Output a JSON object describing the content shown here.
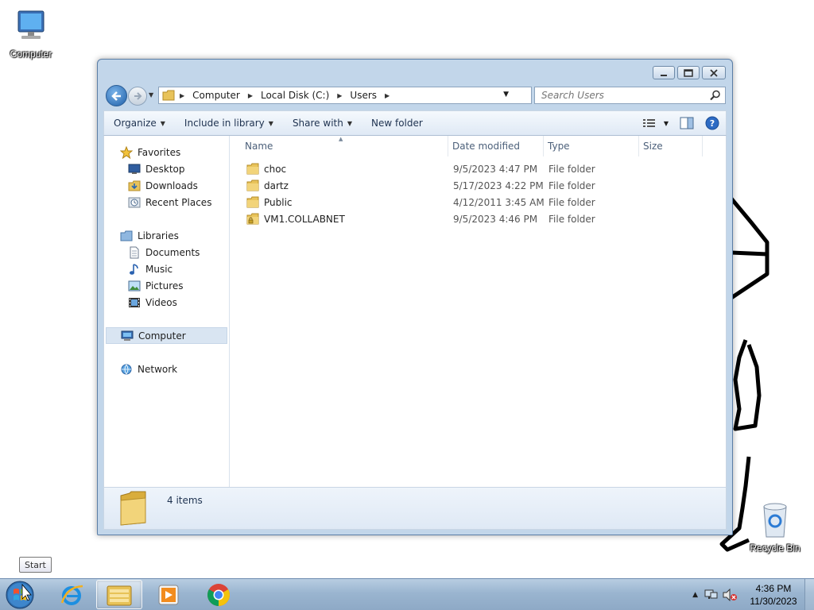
{
  "desktop": {
    "icons": [
      {
        "label": "Computer"
      },
      {
        "label": "Recycle Bin"
      }
    ]
  },
  "explorer": {
    "breadcrumb": [
      "Computer",
      "Local Disk (C:)",
      "Users"
    ],
    "search_placeholder": "Search Users",
    "commands": {
      "organize": "Organize",
      "include_in_library": "Include in library",
      "share_with": "Share with",
      "new_folder": "New folder"
    },
    "nav": {
      "favorites": "Favorites",
      "desktop": "Desktop",
      "downloads": "Downloads",
      "recent_places": "Recent Places",
      "libraries": "Libraries",
      "documents": "Documents",
      "music": "Music",
      "pictures": "Pictures",
      "videos": "Videos",
      "computer": "Computer",
      "network": "Network"
    },
    "columns": {
      "name": "Name",
      "date_modified": "Date modified",
      "type": "Type",
      "size": "Size"
    },
    "files": [
      {
        "name": "choc",
        "date": "9/5/2023 4:47 PM",
        "type": "File folder",
        "locked": false
      },
      {
        "name": "dartz",
        "date": "5/17/2023 4:22 PM",
        "type": "File folder",
        "locked": false
      },
      {
        "name": "Public",
        "date": "4/12/2011 3:45 AM",
        "type": "File folder",
        "locked": false
      },
      {
        "name": "VM1.COLLABNET",
        "date": "9/5/2023 4:46 PM",
        "type": "File folder",
        "locked": true
      }
    ],
    "status": {
      "item_count": "4 items"
    }
  },
  "tooltip": {
    "text": "Start"
  },
  "taskbar": {
    "clock_time": "4:36 PM",
    "clock_date": "11/30/2023"
  },
  "colors": {
    "taskbar": "#9ab5d0",
    "window_frame": "#c2d6ea",
    "folder": "#e8c35a"
  }
}
